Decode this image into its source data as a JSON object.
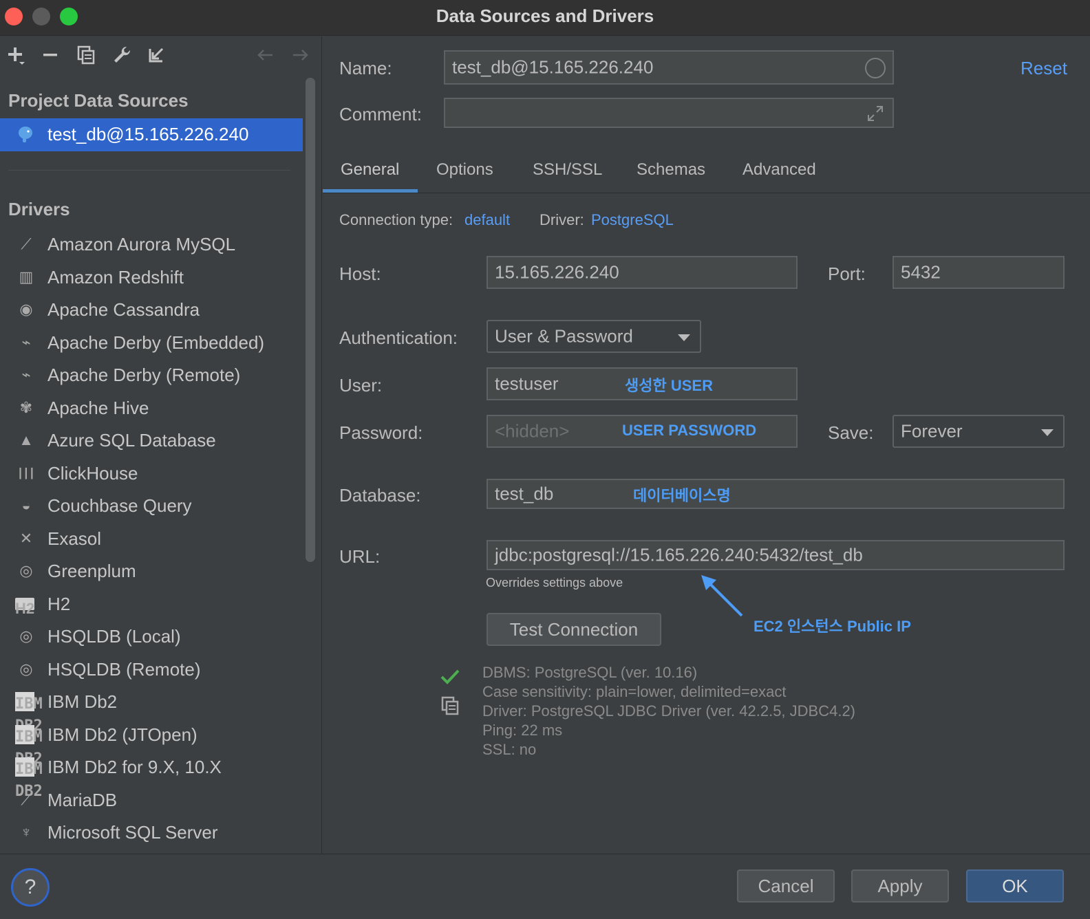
{
  "window": {
    "title": "Data Sources and Drivers"
  },
  "left": {
    "project_header": "Project Data Sources",
    "selected_source": "test_db@15.165.226.240",
    "drivers_header": "Drivers",
    "drivers": [
      {
        "label": "Amazon Aurora MySQL",
        "icon": "aurora-icon"
      },
      {
        "label": "Amazon Redshift",
        "icon": "redshift-icon"
      },
      {
        "label": "Apache Cassandra",
        "icon": "cassandra-icon"
      },
      {
        "label": "Apache Derby (Embedded)",
        "icon": "derby-icon"
      },
      {
        "label": "Apache Derby (Remote)",
        "icon": "derby-icon"
      },
      {
        "label": "Apache Hive",
        "icon": "hive-icon"
      },
      {
        "label": "Azure SQL Database",
        "icon": "azure-icon"
      },
      {
        "label": "ClickHouse",
        "icon": "clickhouse-icon"
      },
      {
        "label": "Couchbase Query",
        "icon": "couchbase-icon"
      },
      {
        "label": "Exasol",
        "icon": "exasol-icon"
      },
      {
        "label": "Greenplum",
        "icon": "greenplum-icon"
      },
      {
        "label": "H2",
        "icon": "h2-icon",
        "badge": "H2"
      },
      {
        "label": "HSQLDB (Local)",
        "icon": "hsqldb-icon"
      },
      {
        "label": "HSQLDB (Remote)",
        "icon": "hsqldb-icon"
      },
      {
        "label": "IBM Db2",
        "icon": "ibm-db2-icon",
        "badge": "IBM DB2"
      },
      {
        "label": "IBM Db2 (JTOpen)",
        "icon": "ibm-db2-icon",
        "badge": "IBM DB2"
      },
      {
        "label": "IBM Db2 for 9.X, 10.X",
        "icon": "ibm-db2-icon",
        "badge": "IBM DB2"
      },
      {
        "label": "MariaDB",
        "icon": "mariadb-icon"
      },
      {
        "label": "Microsoft SQL Server",
        "icon": "mssql-icon"
      }
    ]
  },
  "form": {
    "name_label": "Name:",
    "name_value": "test_db@15.165.226.240",
    "reset_label": "Reset",
    "comment_label": "Comment:",
    "comment_value": "",
    "tabs": [
      "General",
      "Options",
      "SSH/SSL",
      "Schemas",
      "Advanced"
    ],
    "active_tab": "General",
    "connection_type_label": "Connection type:",
    "connection_type_value": "default",
    "driver_label": "Driver:",
    "driver_value": "PostgreSQL",
    "host_label": "Host:",
    "host_value": "15.165.226.240",
    "port_label": "Port:",
    "port_value": "5432",
    "auth_label": "Authentication:",
    "auth_value": "User & Password",
    "user_label": "User:",
    "user_value": "testuser",
    "password_label": "Password:",
    "password_placeholder": "<hidden>",
    "save_label": "Save:",
    "save_value": "Forever",
    "database_label": "Database:",
    "database_value": "test_db",
    "url_label": "URL:",
    "url_value": "jdbc:postgresql://15.165.226.240:5432/test_db",
    "url_hint": "Overrides settings above",
    "test_button": "Test Connection",
    "result_lines": [
      "DBMS: PostgreSQL (ver. 10.16)",
      "Case sensitivity: plain=lower, delimited=exact",
      "Driver: PostgreSQL JDBC Driver (ver. 42.2.5, JDBC4.2)",
      "Ping: 22 ms",
      "SSL: no"
    ]
  },
  "annotations": {
    "user_note": "생성한 USER",
    "password_note": "USER PASSWORD",
    "database_note": "데이터베이스명",
    "ip_note": "EC2 인스턴스 Public IP"
  },
  "footer": {
    "help": "?",
    "cancel": "Cancel",
    "apply": "Apply",
    "ok": "OK"
  },
  "colors": {
    "accent": "#2f65ca",
    "link": "#589df6",
    "annotation": "#4d9cf6",
    "success": "#4caf50"
  }
}
